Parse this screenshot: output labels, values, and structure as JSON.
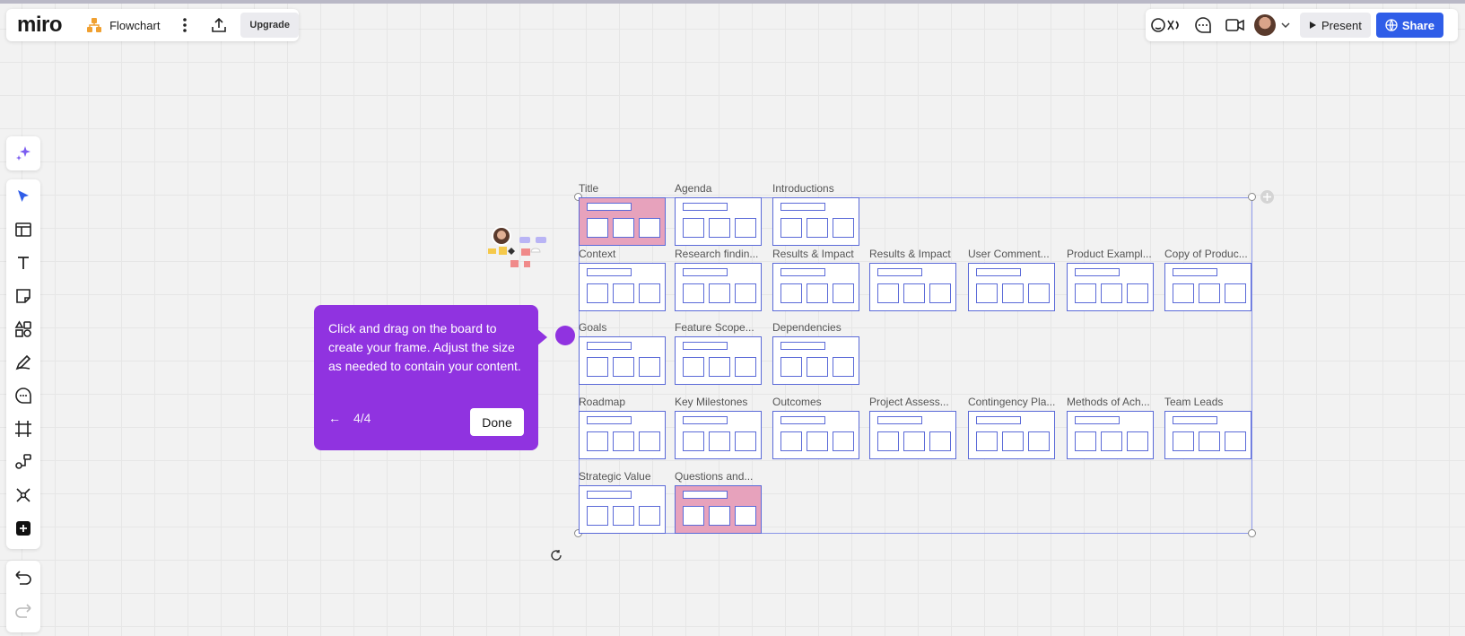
{
  "app": {
    "logo": "miro",
    "board_name": "Flowchart",
    "upgrade_label": "Upgrade"
  },
  "toolbar_right": {
    "present_label": "Present",
    "share_label": "Share"
  },
  "colors": {
    "accent": "#2f5de8",
    "tooltip_bg": "#9033e0",
    "frame_border": "#5b6ad8",
    "frame_pink": "#e7a2bc"
  },
  "tooltip": {
    "text": "Click and drag on the board to create your frame. Adjust the size as needed to contain your content.",
    "back": "←",
    "step": "4/4",
    "done_label": "Done"
  },
  "frames": [
    {
      "label": "Title",
      "style": "pink"
    },
    {
      "label": "Agenda",
      "style": "plain"
    },
    {
      "label": "Introductions",
      "style": "plain"
    },
    {
      "label": "Context",
      "style": "plain"
    },
    {
      "label": "Research findin...",
      "style": "plain"
    },
    {
      "label": "Results & Impact",
      "style": "plain"
    },
    {
      "label": "Results & Impact",
      "style": "plain"
    },
    {
      "label": "User Comment...",
      "style": "plain"
    },
    {
      "label": "Product Exampl...",
      "style": "plain"
    },
    {
      "label": "Copy of Produc...",
      "style": "plain"
    },
    {
      "label": "Goals",
      "style": "plain"
    },
    {
      "label": "Feature Scope...",
      "style": "plain"
    },
    {
      "label": "Dependencies",
      "style": "plain"
    },
    {
      "label": "Roadmap",
      "style": "plain"
    },
    {
      "label": "Key Milestones",
      "style": "plain"
    },
    {
      "label": "Outcomes",
      "style": "plain"
    },
    {
      "label": "Project Assess...",
      "style": "plain"
    },
    {
      "label": "Contingency Pla...",
      "style": "plain"
    },
    {
      "label": "Methods of Ach...",
      "style": "plain"
    },
    {
      "label": "Team Leads",
      "style": "plain"
    },
    {
      "label": "Strategic Value",
      "style": "plain"
    },
    {
      "label": "Questions and...",
      "style": "pink"
    }
  ],
  "icons": {
    "board": "flowchart-icon",
    "more": "more-vertical-icon",
    "export": "export-icon",
    "reactions": "reactions-icon",
    "chat": "chat-icon",
    "video": "video-icon",
    "ai": "sparkle-icon",
    "select": "cursor-icon",
    "templates": "templates-icon",
    "text": "text-icon",
    "sticky": "sticky-note-icon",
    "shapes": "shapes-icon",
    "pen": "pen-icon",
    "comment": "comment-icon",
    "frame": "frame-icon",
    "diagram": "diagram-icon",
    "mindmap": "mindmap-icon",
    "more_tools": "plus-icon",
    "undo": "undo-icon",
    "redo": "redo-icon"
  }
}
